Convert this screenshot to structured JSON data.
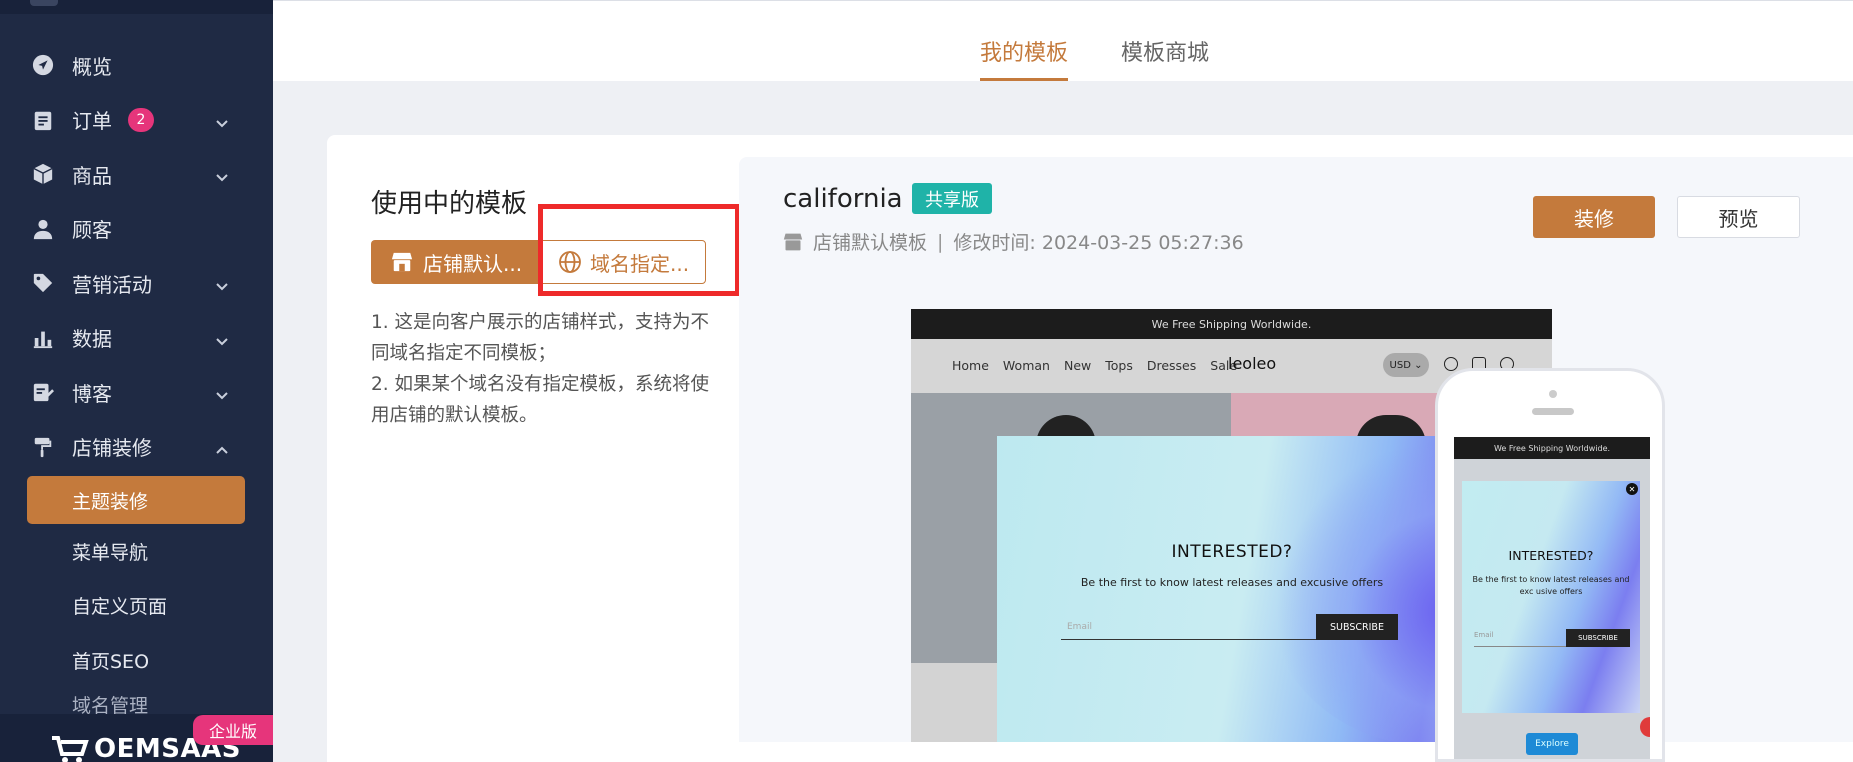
{
  "sidebar": {
    "items": [
      {
        "label": "概览",
        "icon": "navigation-icon"
      },
      {
        "label": "订单",
        "icon": "clipboard-icon",
        "badge": "2"
      },
      {
        "label": "商品",
        "icon": "box-icon"
      },
      {
        "label": "顾客",
        "icon": "user-icon"
      },
      {
        "label": "营销活动",
        "icon": "tag-icon"
      },
      {
        "label": "数据",
        "icon": "bar-chart-icon"
      },
      {
        "label": "博客",
        "icon": "edit-icon"
      },
      {
        "label": "店铺装修",
        "icon": "paint-roller-icon"
      }
    ],
    "sub_items": [
      "主题装修",
      "菜单导航",
      "自定义页面",
      "首页SEO",
      "域名管理"
    ],
    "brand": "OEMSAAS",
    "edition_tag": "企业版"
  },
  "tabs": {
    "my_templates": "我的模板",
    "template_store": "模板商城"
  },
  "left_panel": {
    "title": "使用中的模板",
    "btn_default": "店铺默认...",
    "btn_domain": "域名指定...",
    "desc_1": "1. 这是向客户展示的店铺样式，支持为不同域名指定不同模板；",
    "desc_2": "2. 如果某个域名没有指定模板，系统将使用店铺的默认模板。"
  },
  "template": {
    "name": "california",
    "badge": "共享版",
    "meta_type": "店铺默认模板",
    "meta_time": "修改时间: 2024-03-25 05:27:36",
    "btn_decorate": "装修",
    "btn_preview": "预览"
  },
  "desktop_preview": {
    "ship_banner": "We Free Shipping Worldwide.",
    "nav_links": [
      "Home",
      "Woman",
      "New",
      "Tops",
      "Dresses",
      "Sale"
    ],
    "brand": "leoleo",
    "currency": "USD ⌄",
    "popup_title": "INTERESTED?",
    "popup_sub": "Be the first to know latest releases and excusive offers",
    "email_placeholder": "Email",
    "subscribe": "SUBSCRIBE"
  },
  "mobile_preview": {
    "ship_banner": "We Free Shipping Worldwide.",
    "popup_title": "INTERESTED?",
    "popup_sub": "Be the first to know latest releases and exc usive offers",
    "email_placeholder": "Email",
    "subscribe": "SUBSCRIBE",
    "explore": "Explore"
  },
  "colors": {
    "sidebar_bg": "#1f2a44",
    "accent": "#c47a3c",
    "badge_pink": "#e6357b",
    "share_teal": "#1fb3a8",
    "highlight_red": "#ee2a2a"
  }
}
